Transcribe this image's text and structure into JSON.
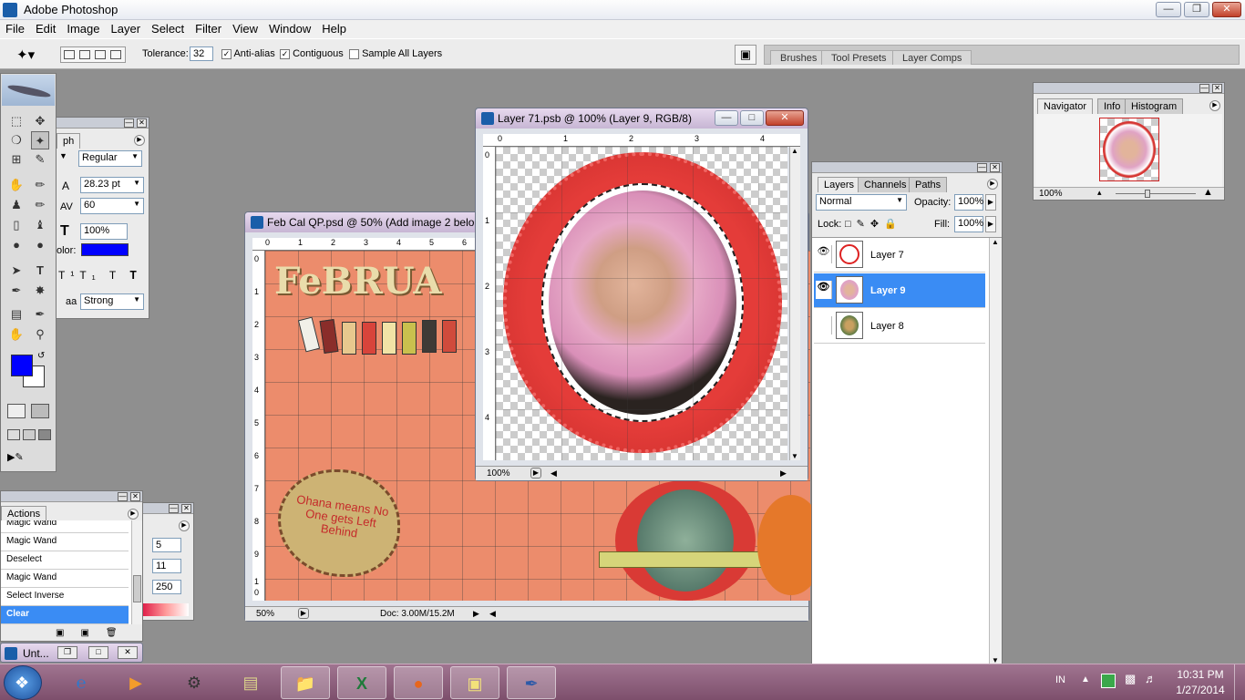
{
  "app": {
    "title": "Adobe Photoshop"
  },
  "menu": [
    "File",
    "Edit",
    "Image",
    "Layer",
    "Select",
    "Filter",
    "View",
    "Window",
    "Help"
  ],
  "options": {
    "tolerance_label": "Tolerance:",
    "tolerance_value": "32",
    "antialias_label": "Anti-alias",
    "contiguous_label": "Contiguous",
    "sample_all_label": "Sample All Layers",
    "palette_tabs": [
      "Brushes",
      "Tool Presets",
      "Layer Comps"
    ]
  },
  "character": {
    "tab_partial": "ph",
    "style": "Regular",
    "size": "28.23 pt",
    "tracking": "60",
    "scale": "100%",
    "color_label": "olor:",
    "color": "#0000ff",
    "antialias": "Strong",
    "aa_label": "aa"
  },
  "doc_back": {
    "title": "Feb Cal QP.psd @ 50% (Add image 2 belo",
    "zoom": "50%",
    "doc_info": "Doc: 3.00M/15.2M",
    "ruler_x": [
      "0",
      "1",
      "2",
      "3",
      "4",
      "5",
      "6"
    ],
    "ruler_y": [
      "0",
      "1",
      "2",
      "3",
      "4",
      "5",
      "6",
      "7",
      "8",
      "9",
      "1",
      "0"
    ],
    "overlay_title": "FeBRUA",
    "doodle_text": "Ohana means No One gets Left Behind"
  },
  "doc_front": {
    "title": "Layer 71.psb @ 100% (Layer 9, RGB/8)",
    "zoom": "100%",
    "ruler_x": [
      "0",
      "1",
      "2",
      "3",
      "4"
    ],
    "ruler_y": [
      "0",
      "1",
      "2",
      "3",
      "4"
    ]
  },
  "navigator": {
    "tabs": [
      "Navigator",
      "Info",
      "Histogram"
    ],
    "zoom": "100%"
  },
  "layers": {
    "tabs": [
      "Layers",
      "Channels",
      "Paths"
    ],
    "blend_mode": "Normal",
    "opacity_label": "Opacity:",
    "opacity": "100%",
    "lock_label": "Lock:",
    "fill_label": "Fill:",
    "fill": "100%",
    "items": [
      {
        "name": "Layer 7",
        "visible": true
      },
      {
        "name": "Layer 9",
        "visible": true
      },
      {
        "name": "Layer 8",
        "visible": false
      }
    ]
  },
  "actions": {
    "tab": "Actions",
    "items": [
      "Magic Wand",
      "Magic Wand",
      "Deselect",
      "Magic Wand",
      "Select Inverse",
      "Clear"
    ]
  },
  "color_panel": {
    "values": [
      "5",
      "11",
      "250"
    ]
  },
  "minimized": {
    "label": "Unt..."
  },
  "taskbar": {
    "lang": "IN",
    "time": "10:31 PM",
    "date": "1/27/2014"
  },
  "colors": {
    "foreground": "#0000ff",
    "selection": "#3a8cf4"
  }
}
